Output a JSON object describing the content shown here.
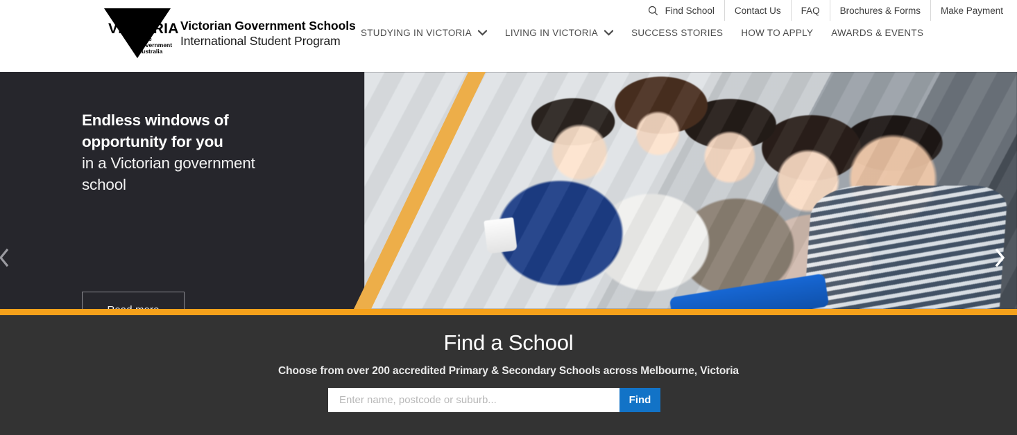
{
  "header": {
    "logo": {
      "wordmark": "VICTORIA",
      "sub_line1": "State",
      "sub_line2": "Government",
      "sub_line3": "Australia",
      "title_line1": "Victorian Government Schools",
      "title_line2": "International Student Program"
    },
    "utility_nav": [
      {
        "label": "Find School",
        "icon": "search-icon"
      },
      {
        "label": "Contact Us"
      },
      {
        "label": "FAQ"
      },
      {
        "label": "Brochures & Forms"
      },
      {
        "label": "Make Payment"
      }
    ],
    "main_nav": [
      {
        "label": "STUDYING IN VICTORIA",
        "has_dropdown": true
      },
      {
        "label": "LIVING IN VICTORIA",
        "has_dropdown": true
      },
      {
        "label": "SUCCESS STORIES",
        "has_dropdown": false
      },
      {
        "label": "HOW TO APPLY",
        "has_dropdown": false
      },
      {
        "label": "AWARDS & EVENTS",
        "has_dropdown": false
      }
    ]
  },
  "hero": {
    "title_line1": "Endless windows of",
    "title_line2": "opportunity for you",
    "sub_line1": "in a Victorian government",
    "sub_line2": "school",
    "cta_label": "Read more",
    "slides_total": 3,
    "active_slide": 1,
    "prev_label": "‹",
    "next_label": "›"
  },
  "find_school": {
    "title": "Find a School",
    "subtitle": "Choose from over 200 accredited Primary & Secondary Schools across Melbourne, Victoria",
    "input_placeholder": "Enter name, postcode or suburb...",
    "input_value": "",
    "button_label": "Find"
  },
  "colors": {
    "gold": "#f5a11b",
    "diagonal_gold": "#edae49",
    "hero_bg": "#26262c",
    "find_bg": "#333333",
    "accent_blue": "#1273c7",
    "header_bg": "#ffffff"
  }
}
